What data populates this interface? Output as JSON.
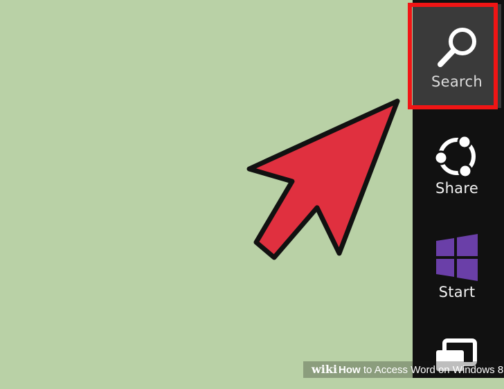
{
  "charms": {
    "search": {
      "label": "Search",
      "icon": "magnifier-icon"
    },
    "share": {
      "label": "Share",
      "icon": "share-icon"
    },
    "start": {
      "label": "Start",
      "icon": "windows-logo-icon"
    },
    "devices": {
      "label": "",
      "icon": "devices-icon"
    }
  },
  "watermark": {
    "brand": "wiki",
    "how": "How",
    "rest": " to Access Word on Windows 8"
  },
  "colors": {
    "background": "#b9d1a6",
    "charms_bar": "#111111",
    "selected_charm": "#3a3a3a",
    "highlight": "#f01515",
    "arrow": "#e0303f",
    "start_logo": "#6a3fa8"
  }
}
